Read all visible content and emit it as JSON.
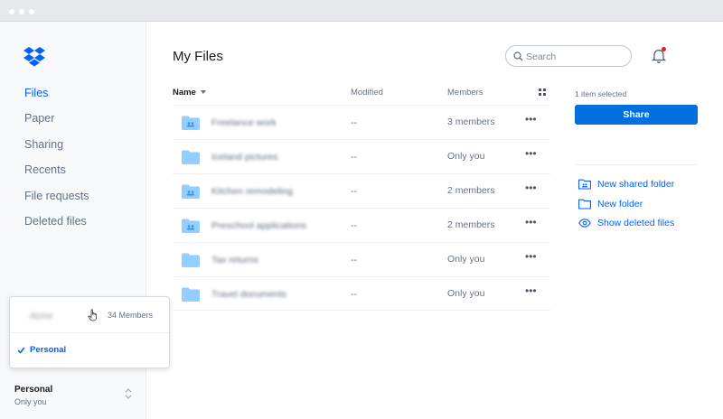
{
  "sidebar": {
    "items": [
      {
        "label": "Files",
        "active": true
      },
      {
        "label": "Paper"
      },
      {
        "label": "Sharing"
      },
      {
        "label": "Recents"
      },
      {
        "label": "File requests"
      },
      {
        "label": "Deleted files"
      }
    ],
    "team_popup": {
      "team_name": "Acme",
      "members": "34 Members",
      "selected": "Personal"
    },
    "account": {
      "name": "Personal",
      "subtitle": "Only you"
    }
  },
  "main": {
    "title": "My Files",
    "search_placeholder": "Search",
    "columns": {
      "name": "Name",
      "modified": "Modified",
      "members": "Members"
    },
    "rows": [
      {
        "name": "Freelance work",
        "type": "shared-folder",
        "modified": "--",
        "members": "3 members"
      },
      {
        "name": "Iceland pictures",
        "type": "folder",
        "modified": "--",
        "members": "Only you"
      },
      {
        "name": "Kitchen remodeling",
        "type": "shared-folder",
        "modified": "--",
        "members": "2 members"
      },
      {
        "name": "Preschool applications",
        "type": "shared-folder",
        "modified": "--",
        "members": "2 members"
      },
      {
        "name": "Tax returns",
        "type": "folder",
        "modified": "--",
        "members": "Only you"
      },
      {
        "name": "Travel documents",
        "type": "folder",
        "modified": "--",
        "members": "Only you"
      }
    ],
    "more_label": "•••"
  },
  "right_panel": {
    "selection_text": "1 item selected",
    "share_label": "Share",
    "actions": [
      {
        "label": "New shared folder",
        "icon": "shared-folder-plus-icon"
      },
      {
        "label": "New folder",
        "icon": "folder-outline-icon"
      },
      {
        "label": "Show deleted files",
        "icon": "eye-icon"
      }
    ]
  },
  "colors": {
    "accent": "#0061fe",
    "share_button": "#0070e0",
    "folder": "#92ceff",
    "notification": "#e02020"
  }
}
